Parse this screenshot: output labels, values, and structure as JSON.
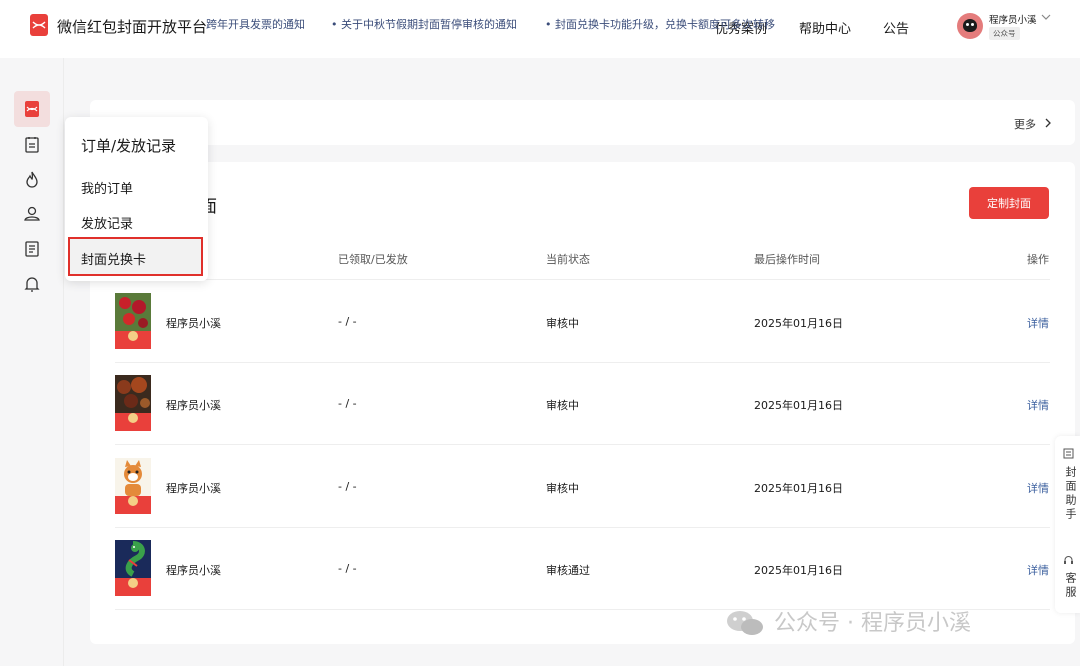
{
  "header": {
    "app_title": "微信红包封面开放平台",
    "nav": [
      "优秀案例",
      "帮助中心",
      "公告"
    ],
    "user_name": "程序员小溪",
    "user_tag": "公众号"
  },
  "notices": {
    "items": [
      "跨年开具发票的通知",
      "• 关于中秋节假期封面暂停审核的通知",
      "• 封面兑换卡功能升级，兑换卡额度可多次转移"
    ],
    "more": "更多"
  },
  "main": {
    "title": "面",
    "create_button": "定制封面",
    "columns": [
      "已领取/已发放",
      "当前状态",
      "最后操作时间",
      "操作"
    ],
    "rows": [
      {
        "name": "程序员小溪",
        "count": "- / -",
        "status": "审核中",
        "time": "2025年01月16日",
        "action": "详情"
      },
      {
        "name": "程序员小溪",
        "count": "- / -",
        "status": "审核中",
        "time": "2025年01月16日",
        "action": "详情"
      },
      {
        "name": "程序员小溪",
        "count": "- / -",
        "status": "审核中",
        "time": "2025年01月16日",
        "action": "详情"
      },
      {
        "name": "程序员小溪",
        "count": "- / -",
        "status": "审核通过",
        "time": "2025年01月16日",
        "action": "详情"
      }
    ]
  },
  "dropdown": {
    "title": "订单/发放记录",
    "items": [
      "我的订单",
      "发放记录",
      "封面兑换卡"
    ]
  },
  "float": {
    "assistant": "封面助手",
    "service": "客服"
  },
  "watermark": "公众号 · 程序员小溪",
  "colors": {
    "accent": "#e9403b",
    "link": "#3b5f9e"
  }
}
